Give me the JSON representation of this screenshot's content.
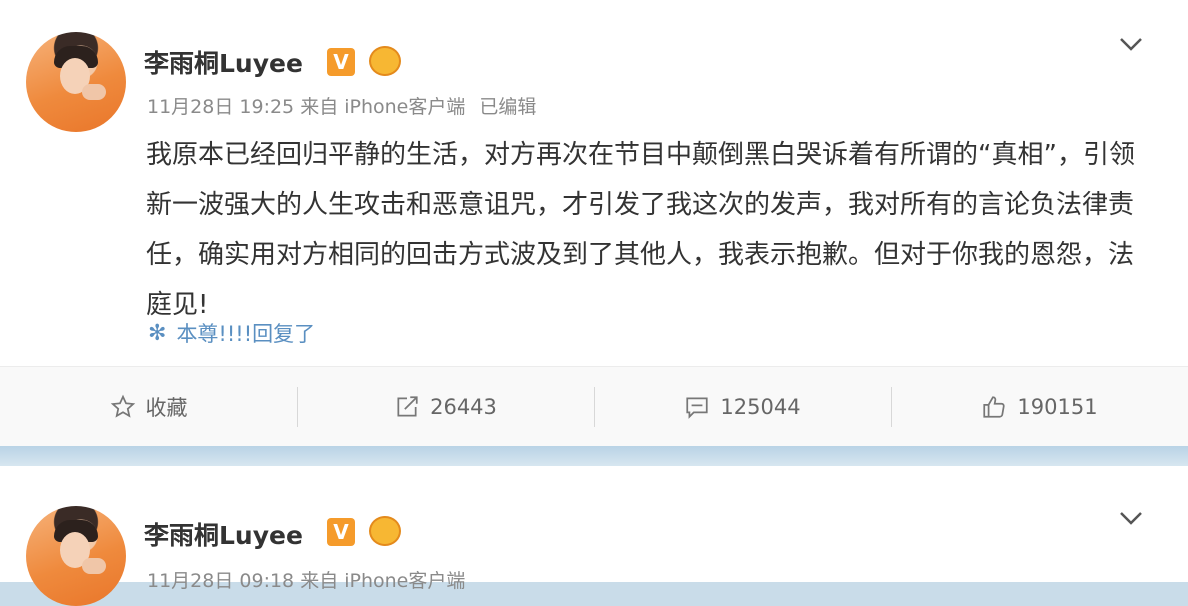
{
  "posts": [
    {
      "user_name": "李雨桐Luyee",
      "verified_badge": "V",
      "vip_badge": "VIP",
      "timestamp": "11月28日 19:25 来自 iPhone客户端",
      "edited": "已编辑",
      "content": "我原本已经回归平静的生活，对方再次在节目中颠倒黑白哭诉着有所谓的“真相”，引领新一波强大的人生攻击和恶意诅咒，才引发了我这次的发声，我对所有的言论负法律责任，确实用对方相同的回击方式波及到了其他人，我表示抱歉。但对于你我的恩怨，法庭见!",
      "reply_text": "本尊!!!!回复了",
      "actions": {
        "favorite_label": "收藏",
        "repost_count": "26443",
        "comment_count": "125044",
        "like_count": "190151"
      }
    },
    {
      "user_name": "李雨桐Luyee",
      "verified_badge": "V",
      "vip_badge": "VIP",
      "timestamp": "11月28日 09:18 来自 iPhone客户端"
    }
  ],
  "watermark": "",
  "colors": {
    "link": "#5a8fc1",
    "verified": "#f59b2b",
    "background": "#c9dce9"
  }
}
